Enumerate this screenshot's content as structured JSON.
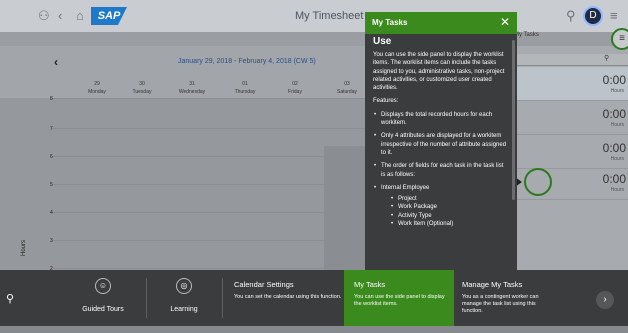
{
  "shell": {
    "title": "My Timesheet",
    "chevron": "∨",
    "user_initial": "D",
    "logo_text": "SAP"
  },
  "calendar": {
    "prev_arrow": "‹",
    "range": "January 29, 2018 - February 4, 2018 (CW 5)",
    "days": [
      {
        "date": "29",
        "name": "Monday"
      },
      {
        "date": "30",
        "name": "Tuesday"
      },
      {
        "date": "31",
        "name": "Wednesday"
      },
      {
        "date": "01",
        "name": "Thursday"
      },
      {
        "date": "02",
        "name": "Friday"
      },
      {
        "date": "03",
        "name": "Saturday"
      }
    ],
    "hour_labels": [
      "8",
      "7",
      "6",
      "5",
      "4",
      "3",
      "2"
    ],
    "axis_label": "Hours"
  },
  "panel": {
    "header": "My Tasks",
    "tasks": [
      {
        "value": "0:00",
        "unit": "Hours"
      },
      {
        "value": "0:00",
        "unit": "Hours"
      },
      {
        "value": "0:00",
        "unit": "Hours"
      },
      {
        "value": "0:00",
        "unit": "Hours"
      }
    ]
  },
  "popover": {
    "header": "My Tasks",
    "heading": "Use",
    "intro": "You can use the side panel to display the worklist items. The worklist items can include the tasks assigned to you, administrative tasks, non-project related activities, or customized user created activities.",
    "features_label": "Features:",
    "features": [
      "Displays the total recorded hours for each workitem.",
      "Only 4 attributes are displayed for a workitem irrespective of the number of attribute assigned to it.",
      "The order of fields for each task in the task list is as follows:"
    ],
    "sub_heading": "Internal Employee",
    "sub_items": [
      "Project",
      "Work Package",
      "Activity Type",
      "Work Item (Optional)"
    ]
  },
  "bottom": {
    "tiles": [
      {
        "label": "Guided Tours",
        "icon": "☺"
      },
      {
        "label": "Learning",
        "icon": "◎"
      }
    ],
    "cards": [
      {
        "title": "Calendar Settings",
        "desc": "You can set the calendar using this function."
      },
      {
        "title": "My Tasks",
        "desc": "You can use the side panel to display the worklist items."
      },
      {
        "title": "Manage My Tasks",
        "desc": "You as a contingent worker can manage the task list using this function."
      }
    ],
    "next": "›"
  },
  "colors": {
    "accent_green": "#3a8a1d",
    "popover_dark": "#3a3c3e",
    "sap_blue": "#1f79c9"
  },
  "icons": [
    "person-icon",
    "back-icon",
    "home-icon",
    "search-icon",
    "menu-icon",
    "close-icon",
    "next-icon"
  ]
}
